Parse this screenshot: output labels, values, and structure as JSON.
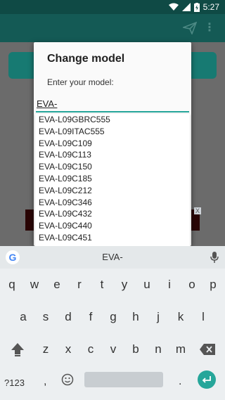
{
  "status_bar": {
    "time": "5:27"
  },
  "dialog": {
    "title": "Change model",
    "message": "Enter your model:",
    "input_value": "EVA-",
    "suggestions": [
      "EVA-L09GBRC555",
      "EVA-L09ITAC555",
      "EVA-L09C109",
      "EVA-L09C113",
      "EVA-L09C150",
      "EVA-L09C185",
      "EVA-L09C212",
      "EVA-L09C346",
      "EVA-L09C432",
      "EVA-L09C440",
      "EVA-L09C451"
    ]
  },
  "ad": {
    "close": "X"
  },
  "keyboard": {
    "suggestion": "EVA-",
    "google_logo": "G",
    "row1": [
      "q",
      "w",
      "e",
      "r",
      "t",
      "y",
      "u",
      "i",
      "o",
      "p"
    ],
    "row2": [
      "a",
      "s",
      "d",
      "f",
      "g",
      "h",
      "j",
      "k",
      "l"
    ],
    "row3": [
      "z",
      "x",
      "c",
      "v",
      "b",
      "n",
      "m"
    ],
    "symbols": "?123",
    "comma": ",",
    "period": "."
  },
  "colors": {
    "accent": "#26a69a",
    "appbar": "#145a55",
    "dialog_bg": "#fafafa"
  }
}
